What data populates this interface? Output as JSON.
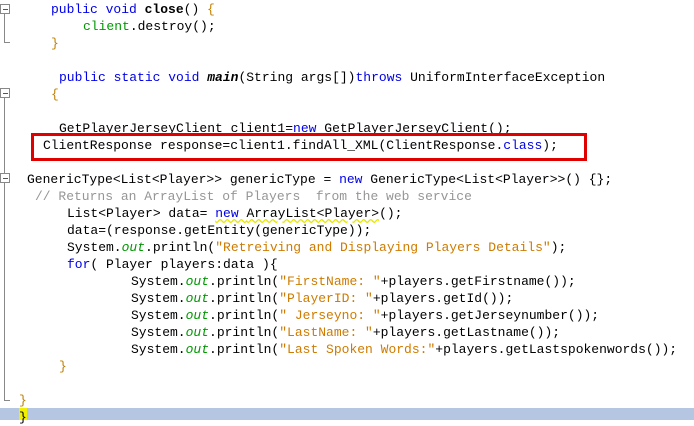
{
  "editor": {
    "lines": [
      {
        "indent": 51,
        "row": 0,
        "segs": [
          [
            "public void ",
            "kw"
          ],
          [
            "close",
            "bold"
          ],
          [
            "() ",
            ""
          ],
          [
            "{",
            "brace"
          ]
        ]
      },
      {
        "indent": 83,
        "row": 1,
        "segs": [
          [
            "client",
            "fld"
          ],
          [
            ".destroy();",
            ""
          ]
        ]
      },
      {
        "indent": 51,
        "row": 2,
        "segs": [
          [
            "}",
            "brace"
          ]
        ]
      },
      {
        "indent": 59,
        "row": 4,
        "segs": [
          [
            "public static void ",
            "kw"
          ],
          [
            "main",
            "bi"
          ],
          [
            "(String args[])",
            ""
          ],
          [
            "throws ",
            "kw"
          ],
          [
            "UniformInterfaceException",
            ""
          ]
        ]
      },
      {
        "indent": 51,
        "row": 5,
        "segs": [
          [
            "{",
            "brace"
          ]
        ]
      },
      {
        "indent": 59,
        "row": 7,
        "segs": [
          [
            "GetPlayerJerseyClient client1=",
            ""
          ],
          [
            "new ",
            "kw"
          ],
          [
            "GetPlayerJerseyClient();",
            ""
          ]
        ]
      },
      {
        "indent": 43,
        "row": 8,
        "segs": [
          [
            "ClientResponse response=client1.findAll_XML(ClientResponse.",
            ""
          ],
          [
            "class",
            "kw"
          ],
          [
            ");",
            ""
          ]
        ]
      },
      {
        "indent": 27,
        "row": 10,
        "segs": [
          [
            "GenericType<List<Player>> genericType = ",
            ""
          ],
          [
            "new ",
            "kw"
          ],
          [
            "GenericType<List<Player>>() {};",
            ""
          ]
        ]
      },
      {
        "indent": 35,
        "row": 11,
        "segs": [
          [
            "// Returns an ArrayList of Players  from the web service",
            "cm"
          ]
        ]
      },
      {
        "indent": 67,
        "row": 12,
        "segs": [
          [
            "List<Player> data= ",
            ""
          ],
          [
            "new ArrayList<Player>",
            "squigkw"
          ],
          [
            "();",
            ""
          ]
        ]
      },
      {
        "indent": 67,
        "row": 13,
        "segs": [
          [
            "data=(response.getEntity(genericType));",
            ""
          ]
        ]
      },
      {
        "indent": 67,
        "row": 14,
        "segs": [
          [
            "System.",
            ""
          ],
          [
            "out",
            "ital"
          ],
          [
            ".println(",
            ""
          ],
          [
            "\"Retreiving and Displaying Players Details\"",
            "str"
          ],
          [
            ");",
            ""
          ]
        ]
      },
      {
        "indent": 67,
        "row": 15,
        "segs": [
          [
            "for",
            "kw"
          ],
          [
            "( Player players:data ){",
            ""
          ]
        ]
      },
      {
        "indent": 131,
        "row": 16,
        "segs": [
          [
            "System.",
            ""
          ],
          [
            "out",
            "ital"
          ],
          [
            ".println(",
            ""
          ],
          [
            "\"FirstName: \"",
            "str"
          ],
          [
            "+players.getFirstname());",
            ""
          ]
        ]
      },
      {
        "indent": 131,
        "row": 17,
        "segs": [
          [
            "System.",
            ""
          ],
          [
            "out",
            "ital"
          ],
          [
            ".println(",
            ""
          ],
          [
            "\"PlayerID: \"",
            "str"
          ],
          [
            "+players.getId());",
            ""
          ]
        ]
      },
      {
        "indent": 131,
        "row": 18,
        "segs": [
          [
            "System.",
            ""
          ],
          [
            "out",
            "ital"
          ],
          [
            ".println(",
            ""
          ],
          [
            "\" Jerseyno: \"",
            "str"
          ],
          [
            "+players.getJerseynumber());",
            ""
          ]
        ]
      },
      {
        "indent": 131,
        "row": 19,
        "segs": [
          [
            "System.",
            ""
          ],
          [
            "out",
            "ital"
          ],
          [
            ".println(",
            ""
          ],
          [
            "\"LastName: \"",
            "str"
          ],
          [
            "+players.getLastname());",
            ""
          ]
        ]
      },
      {
        "indent": 131,
        "row": 20,
        "segs": [
          [
            "System.",
            ""
          ],
          [
            "out",
            "ital"
          ],
          [
            ".println(",
            ""
          ],
          [
            "\"Last Spoken Words:\"",
            "str"
          ],
          [
            "+players.getLastspokenwords());",
            ""
          ]
        ]
      },
      {
        "indent": 59,
        "row": 21,
        "segs": [
          [
            "}",
            "brace"
          ]
        ]
      },
      {
        "indent": 19,
        "row": 23,
        "segs": [
          [
            "}",
            "brace"
          ]
        ]
      },
      {
        "indent": 19,
        "row": 24,
        "segs": [
          [
            "}",
            ""
          ]
        ]
      }
    ]
  }
}
